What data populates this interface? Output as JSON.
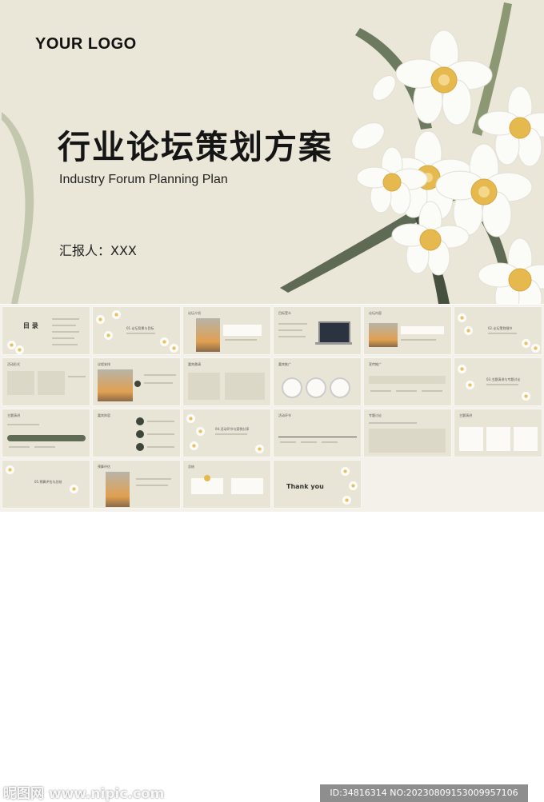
{
  "hero": {
    "logo": "YOUR LOGO",
    "title": "行业论坛策划方案",
    "subtitle": "Industry Forum Planning Plan",
    "presenter": "汇报人：XXX"
  },
  "thumbnails": [
    {
      "title": "目 录"
    },
    {
      "title": "01.论坛背景与目标"
    },
    {
      "title": "论坛介绍"
    },
    {
      "title": "目标受众"
    },
    {
      "title": "论坛内容"
    },
    {
      "title": "02.论坛策划细节"
    },
    {
      "title": "活动形式"
    },
    {
      "title": "议程安排"
    },
    {
      "title": "嘉宾邀请"
    },
    {
      "title": "嘉宾推广"
    },
    {
      "title": "宣传推广"
    },
    {
      "title": "03.主题演讲与专题讨论"
    },
    {
      "title": "主题演讲"
    },
    {
      "title": "嘉宾阵容"
    },
    {
      "title": "04.活动环节与案例分享"
    },
    {
      "title": "活动环节"
    },
    {
      "title": "专题讨论"
    },
    {
      "title": "主题演讲"
    },
    {
      "title": "05.预算评估与总结"
    },
    {
      "title": "预算评估"
    },
    {
      "title": "总结"
    },
    {
      "title": "Thank you"
    }
  ],
  "watermark": {
    "site": "昵图网 www.nipic.com",
    "id_text": "ID:34816314 NO:20230809153009957106"
  },
  "colors": {
    "background": "#ebe7d8",
    "leaf": "#5f6b55",
    "petal": "#fbfbf7",
    "center": "#e6b94e"
  }
}
